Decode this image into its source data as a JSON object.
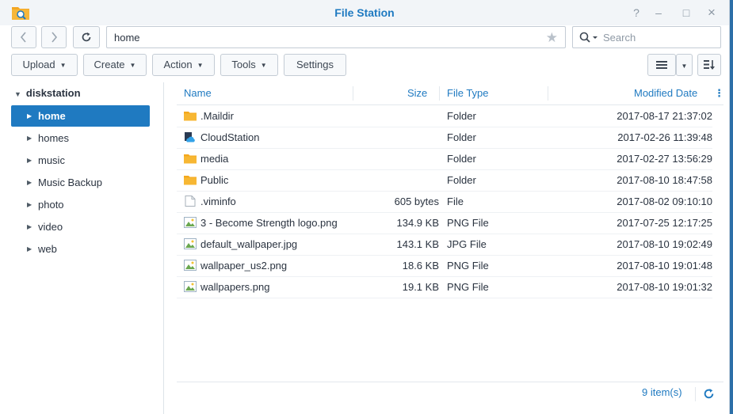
{
  "window": {
    "title": "File Station",
    "controls": [
      "?",
      "–",
      "□",
      "×"
    ]
  },
  "nav": {
    "path": "home",
    "search_placeholder": "Search"
  },
  "toolbar": {
    "upload": "Upload",
    "create": "Create",
    "action": "Action",
    "tools": "Tools",
    "settings": "Settings"
  },
  "tree": {
    "root": "diskstation",
    "items": [
      {
        "label": "home",
        "selected": true
      },
      {
        "label": "homes"
      },
      {
        "label": "music"
      },
      {
        "label": "Music Backup"
      },
      {
        "label": "photo"
      },
      {
        "label": "video"
      },
      {
        "label": "web"
      }
    ]
  },
  "columns": {
    "name": "Name",
    "size": "Size",
    "type": "File Type",
    "modified": "Modified Date"
  },
  "files": [
    {
      "name": ".Maildir",
      "size": "",
      "type": "Folder",
      "modified": "2017-08-17 21:37:02",
      "icon": "folder-icon"
    },
    {
      "name": "CloudStation",
      "size": "",
      "type": "Folder",
      "modified": "2017-02-26 11:39:48",
      "icon": "cloudstation-folder-icon"
    },
    {
      "name": "media",
      "size": "",
      "type": "Folder",
      "modified": "2017-02-27 13:56:29",
      "icon": "folder-icon"
    },
    {
      "name": "Public",
      "size": "",
      "type": "Folder",
      "modified": "2017-08-10 18:47:58",
      "icon": "folder-icon"
    },
    {
      "name": ".viminfo",
      "size": "605 bytes",
      "type": "File",
      "modified": "2017-08-02 09:10:10",
      "icon": "file-icon"
    },
    {
      "name": "3 - Become Strength logo.png",
      "size": "134.9 KB",
      "type": "PNG File",
      "modified": "2017-07-25 12:17:25",
      "icon": "image-file-icon"
    },
    {
      "name": "default_wallpaper.jpg",
      "size": "143.1 KB",
      "type": "JPG File",
      "modified": "2017-08-10 19:02:49",
      "icon": "image-file-icon"
    },
    {
      "name": "wallpaper_us2.png",
      "size": "18.6 KB",
      "type": "PNG File",
      "modified": "2017-08-10 19:01:48",
      "icon": "image-file-icon"
    },
    {
      "name": "wallpapers.png",
      "size": "19.1 KB",
      "type": "PNG File",
      "modified": "2017-08-10 19:01:32",
      "icon": "image-file-icon"
    }
  ],
  "status": {
    "count": "9 item(s)"
  },
  "colors": {
    "accent": "#1f7ac1",
    "folder": "#f4a81d"
  }
}
